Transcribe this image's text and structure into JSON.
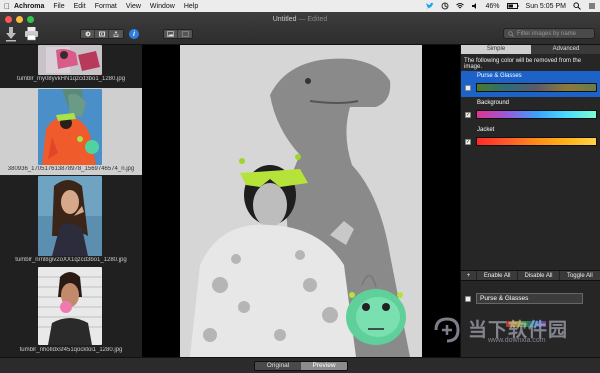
{
  "menubar": {
    "app_name": "Achroma",
    "items": [
      "File",
      "Edit",
      "Format",
      "View",
      "Window",
      "Help"
    ],
    "battery": "46%",
    "clock": "Sun 5:05 PM"
  },
  "window": {
    "title": "Untitled",
    "edited": "— Edited"
  },
  "toolbar": {
    "search_placeholder": "Filter images by name",
    "info_label": "i"
  },
  "sidebar": {
    "thumbnails": [
      {
        "caption": "tumblr_my08yvkHN1qzcd3bo1_1280.jpg",
        "selected": false
      },
      {
        "caption": "380936_170517613878978_1569746574_n.jpg",
        "selected": true
      },
      {
        "caption": "tumblr_nrnl8giv2oXX1qzcd3bo1_1280.jpg",
        "selected": false
      },
      {
        "caption": "tumblr_nhoIldxsf451qocktoi1_1280.jpg",
        "selected": false
      }
    ]
  },
  "viewer": {
    "tabs": [
      {
        "label": "Original",
        "active": false
      },
      {
        "label": "Preview",
        "active": true
      }
    ]
  },
  "panel": {
    "tabs": [
      {
        "label": "Simple",
        "active": true
      },
      {
        "label": "Advanced",
        "active": false
      }
    ],
    "info": "The following color will be removed from the image.",
    "colors": [
      {
        "name": "Purse & Glasses",
        "checked": false,
        "selected": true
      },
      {
        "name": "Background",
        "checked": true,
        "selected": false
      },
      {
        "name": "Jacket",
        "checked": true,
        "selected": false
      }
    ],
    "actions": {
      "add": "+",
      "enable_all": "Enable All",
      "disable_all": "Disable All",
      "toggle_all": "Toggle All"
    },
    "edit_name": "Purse & Glasses"
  },
  "watermark": {
    "text": "当下软件园",
    "sub": "www.downxia.com"
  },
  "colors": {
    "accent": "#1c62c9",
    "purse_gradient": [
      "#4a7a2a",
      "#2f6b7a",
      "#5a5a6a",
      "#8a7a3a",
      "#6a7a4a"
    ],
    "background_gradient": [
      "#e0338f",
      "#9b59d9",
      "#3aa0ff",
      "#4cd9ff",
      "#7affd0"
    ],
    "jacket_gradient": [
      "#ff2a2a",
      "#ff5a2a",
      "#ff8c1a",
      "#ffb31a",
      "#ffd24a"
    ]
  }
}
